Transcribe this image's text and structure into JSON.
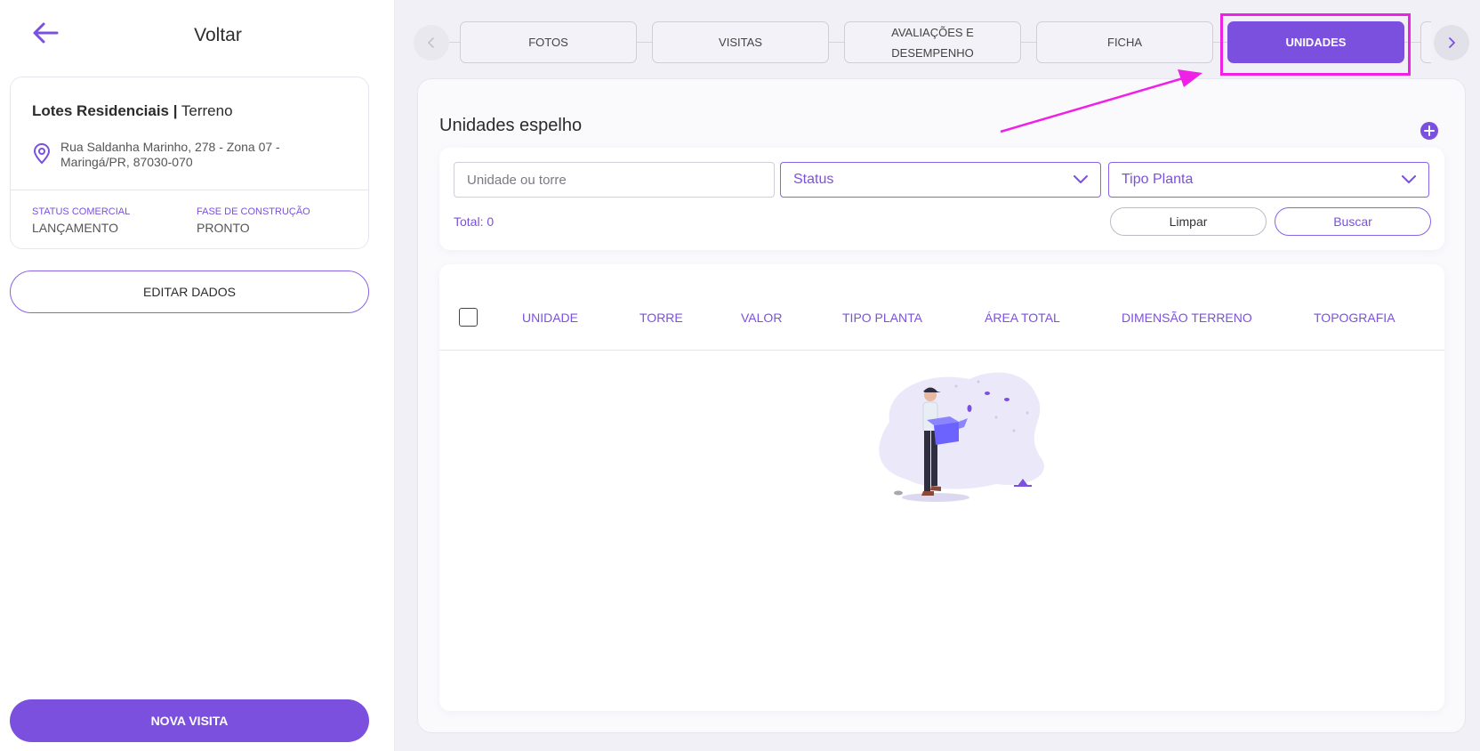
{
  "sidebar": {
    "back_label": "Voltar",
    "property": {
      "name": "Lotes Residenciais |",
      "type": "Terreno",
      "address_line1": "Rua Saldanha Marinho, 278 - Zona 07 -",
      "address_line2": "Maringá/PR, 87030-070",
      "status_label": "STATUS COMERCIAL",
      "status_value": "LANÇAMENTO",
      "phase_label": "FASE DE CONSTRUÇÃO",
      "phase_value": "PRONTO"
    },
    "edit_button": "EDITAR DADOS",
    "new_visit_button": "NOVA VISITA"
  },
  "tabs": {
    "items": [
      {
        "label": "FOTOS"
      },
      {
        "label": "VISITAS"
      },
      {
        "label": "AVALIAÇÕES E DESEMPENHO"
      },
      {
        "label": "FICHA"
      },
      {
        "label": "UNIDADES"
      }
    ],
    "active": "UNIDADES"
  },
  "main": {
    "title": "Unidades espelho",
    "filters": {
      "search_placeholder": "Unidade ou torre",
      "status_placeholder": "Status",
      "plan_placeholder": "Tipo Planta",
      "total": "Total: 0",
      "clear_button": "Limpar",
      "search_button": "Buscar"
    },
    "table": {
      "columns": [
        "UNIDADE",
        "TORRE",
        "VALOR",
        "TIPO PLANTA",
        "ÁREA TOTAL",
        "DIMENSÃO TERRENO",
        "TOPOGRAFIA"
      ],
      "rows": []
    }
  },
  "colors": {
    "accent": "#7c50de",
    "annotation": "#f021e6",
    "background": "#f1f0f7"
  },
  "icons": [
    "back-arrow-icon",
    "location-pin-icon",
    "chevron-left-icon",
    "chevron-right-icon",
    "plus-icon",
    "chevron-down-icon",
    "empty-box-illustration"
  ]
}
